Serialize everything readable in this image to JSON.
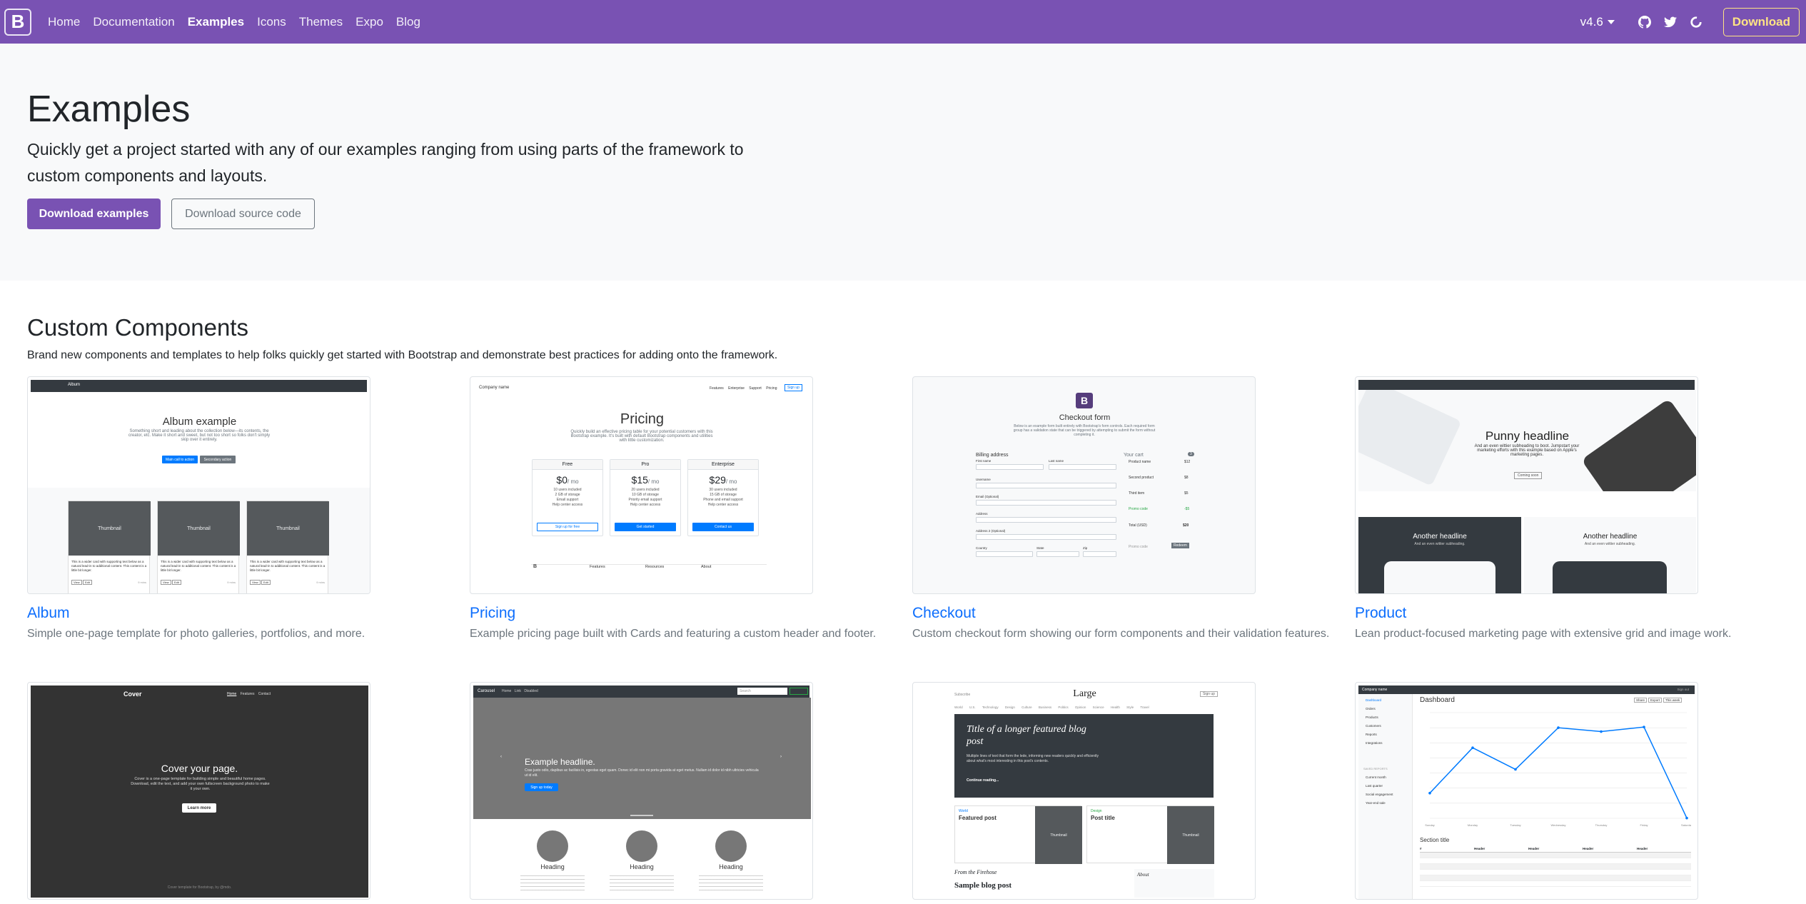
{
  "navbar": {
    "brand": "B",
    "links": [
      "Home",
      "Documentation",
      "Examples",
      "Icons",
      "Themes",
      "Expo",
      "Blog"
    ],
    "active": "Examples",
    "version": "v4.6",
    "download": "Download",
    "icons": [
      "github-icon",
      "twitter-icon",
      "opencollective-icon"
    ]
  },
  "hero": {
    "title": "Examples",
    "lead": "Quickly get a project started with any of our examples ranging from using parts of the framework to custom components and layouts.",
    "primary_button": "Download examples",
    "secondary_button": "Download source code"
  },
  "section": {
    "title": "Custom Components",
    "description": "Brand new components and templates to help folks quickly get started with Bootstrap and demonstrate best practices for adding onto the framework."
  },
  "examples": [
    {
      "title": "Album",
      "description": "Simple one-page template for photo galleries, portfolios, and more."
    },
    {
      "title": "Pricing",
      "description": "Example pricing page built with Cards and featuring a custom header and footer."
    },
    {
      "title": "Checkout",
      "description": "Custom checkout form showing our form components and their validation features."
    },
    {
      "title": "Product",
      "description": "Lean product-focused marketing page with extensive grid and image work."
    }
  ],
  "thumbs": {
    "album": {
      "nav": "Album",
      "heading": "Album example",
      "text": "Something short and leading about the collection below—its contents, the creator, etc. Make it short and sweet, but not too short so folks don't simply skip over it entirely.",
      "btn1": "Main call to action",
      "btn2": "Secondary action",
      "thumb_label": "Thumbnail",
      "card_text": "This is a wider card with supporting text below as a natural lead-in to additional content. This content is a little bit longer.",
      "view": "View",
      "edit": "Edit",
      "mins": "9 mins"
    },
    "pricing": {
      "company": "Company name",
      "nav": [
        "Features",
        "Enterprise",
        "Support",
        "Pricing"
      ],
      "signup": "Sign up",
      "heading": "Pricing",
      "text": "Quickly build an effective pricing table for your potential customers with this Bootstrap example. It's built with default Bootstrap components and utilities with little customization.",
      "plans": [
        {
          "name": "Free",
          "price": "$0",
          "features": [
            "10 users included",
            "2 GB of storage",
            "Email support",
            "Help center access"
          ],
          "cta": "Sign up for free"
        },
        {
          "name": "Pro",
          "price": "$15",
          "features": [
            "20 users included",
            "10 GB of storage",
            "Priority email support",
            "Help center access"
          ],
          "cta": "Get started"
        },
        {
          "name": "Enterprise",
          "price": "$29",
          "features": [
            "30 users included",
            "15 GB of storage",
            "Phone and email support",
            "Help center access"
          ],
          "cta": "Contact us"
        }
      ],
      "per": "/ mo",
      "footer": [
        "Features",
        "Resources",
        "About"
      ]
    },
    "checkout": {
      "heading": "Checkout form",
      "text": "Below is an example form built entirely with Bootstrap's form controls. Each required form group has a validation state that can be triggered by attempting to submit the form without completing it.",
      "billing": "Billing address",
      "cart": "Your cart",
      "cart_count": "3",
      "labels": [
        "First name",
        "Last name",
        "Username",
        "Email (Optional)",
        "Address",
        "Address 2 (Optional)",
        "Country",
        "State",
        "Zip"
      ],
      "items": [
        {
          "name": "Product name",
          "price": "$12"
        },
        {
          "name": "Second product",
          "price": "$8"
        },
        {
          "name": "Third item",
          "price": "$5"
        },
        {
          "name": "Promo code",
          "price": "-$5"
        }
      ],
      "total_label": "Total (USD)",
      "total": "$20",
      "redeem": "Redeem",
      "promo_placeholder": "Promo code"
    },
    "product": {
      "heading": "Punny headline",
      "text": "And an even wittier subheading to boot. Jumpstart your marketing efforts with this example based on Apple's marketing pages.",
      "btn": "Coming soon",
      "sub1": "Another headline",
      "sub2": "Another headline",
      "subtext": "And an even wittier subheading."
    },
    "cover": {
      "brand": "Cover",
      "nav": [
        "Home",
        "Features",
        "Contact"
      ],
      "heading": "Cover your page.",
      "text": "Cover is a one-page template for building simple and beautiful home pages. Download, edit the text, and add your own fullscreen background photo to make it your own.",
      "btn": "Learn more",
      "footer": "Cover template for Bootstrap, by @mdo."
    },
    "carousel": {
      "brand": "Carousel",
      "nav": [
        "Home",
        "Link",
        "Disabled"
      ],
      "search": "Search",
      "heading": "Example headline.",
      "text": "Cras justo odio, dapibus ac facilisis in, egestas eget quam. Donec id elit non mi porta gravida at eget metus. Nullam id dolor id nibh ultricies vehicula ut id elit.",
      "btn": "Sign up today",
      "col_heading": "Heading"
    },
    "blog": {
      "subscribe": "Subscribe",
      "title": "Large",
      "signup": "Sign up",
      "nav": [
        "World",
        "U.S.",
        "Technology",
        "Design",
        "Culture",
        "Business",
        "Politics",
        "Opinion",
        "Science",
        "Health",
        "Style",
        "Travel"
      ],
      "featured": "Title of a longer featured blog post",
      "featured_text": "Multiple lines of text that form the lede, informing new readers quickly and efficiently about what's most interesting in this post's contents.",
      "continue": "Continue reading...",
      "post1_cat": "World",
      "post1_title": "Featured post",
      "post2_cat": "Design",
      "post2_title": "Post title",
      "thumb_label": "Thumbnail",
      "firehose": "From the Firehose",
      "sample": "Sample blog post",
      "about": "About"
    },
    "dashboard": {
      "company": "Company name",
      "signout": "Sign out",
      "title": "Dashboard",
      "sidebar": [
        "Dashboard",
        "Orders",
        "Products",
        "Customers",
        "Reports",
        "Integrations"
      ],
      "saved": "SAVED REPORTS",
      "reports": [
        "Current month",
        "Last quarter",
        "Social engagement",
        "Year-end sale"
      ],
      "buttons": [
        "Share",
        "Export",
        "This week"
      ],
      "section": "Section title",
      "table_head": [
        "#",
        "Header",
        "Header",
        "Header",
        "Header"
      ]
    }
  },
  "chart_data": {
    "type": "line",
    "title": "",
    "categories": [
      "Sunday",
      "Monday",
      "Tuesday",
      "Wednesday",
      "Thursday",
      "Friday",
      "Saturday"
    ],
    "series": [
      {
        "values": [
          15339,
          21345,
          18483,
          24003,
          23489,
          24092,
          12034
        ]
      }
    ],
    "ylim": [
      12000,
      26000
    ],
    "color": "#007bff"
  },
  "colors": {
    "brand": "#7952b3",
    "link": "#0d6efd",
    "download": "#ffe484",
    "dark": "#343a40"
  }
}
